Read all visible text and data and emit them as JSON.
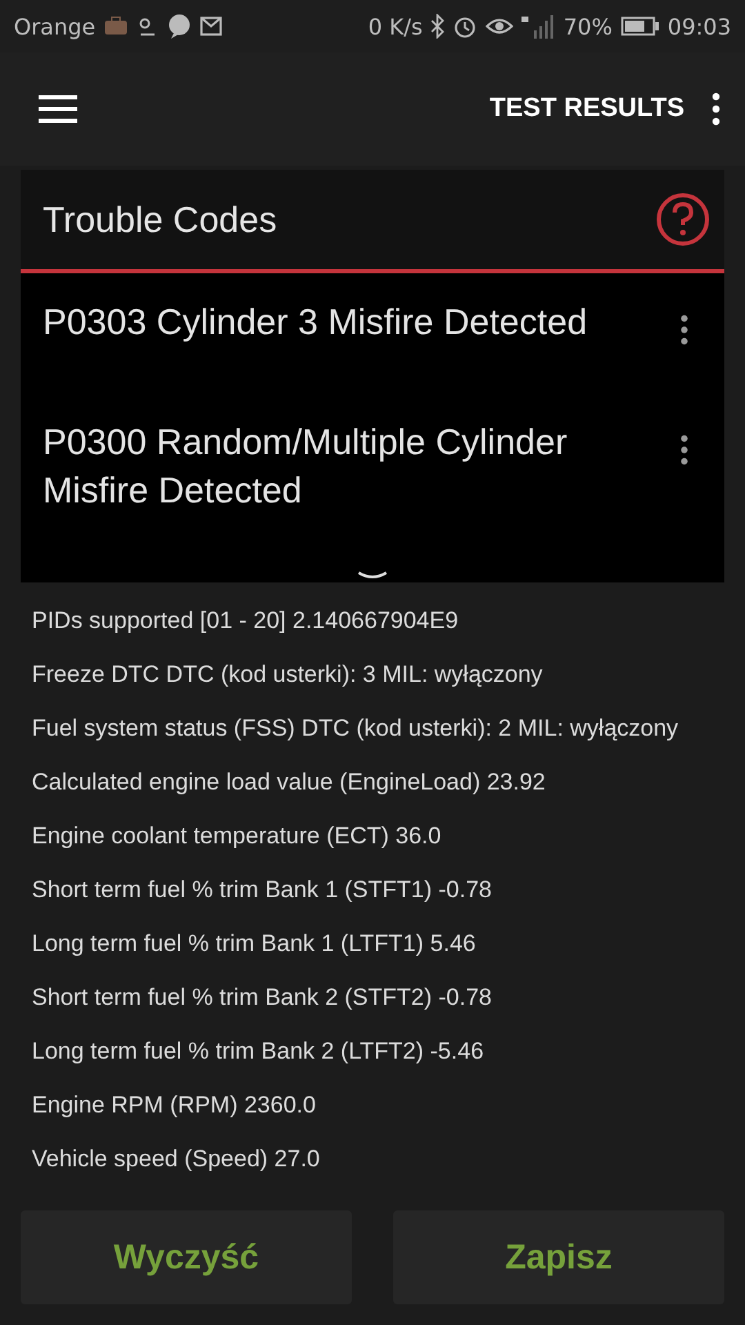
{
  "status_bar": {
    "carrier": "Orange",
    "speed": "0 K/s",
    "battery": "70%",
    "time": "09:03"
  },
  "app_bar": {
    "title": "TEST RESULTS"
  },
  "trouble_codes": {
    "title": "Trouble Codes",
    "codes": [
      {
        "code": "P0303",
        "description": "Cylinder 3 Misfire Detected"
      },
      {
        "code": "P0300",
        "description": "Random/Multiple Cylinder Misfire Detected"
      }
    ]
  },
  "readings": [
    "PIDs supported [01 - 20] 2.140667904E9",
    "Freeze DTC DTC (kod usterki): 3 MIL: wyłączony",
    "Fuel system status (FSS) DTC (kod usterki): 2 MIL: wyłączony",
    "Calculated engine load value (EngineLoad) 23.92",
    "Engine coolant temperature (ECT) 36.0",
    "Short term fuel % trim Bank 1 (STFT1) -0.78",
    "Long term fuel % trim Bank 1 (LTFT1) 5.46",
    "Short term fuel % trim Bank 2 (STFT2) -0.78",
    "Long term fuel % trim Bank 2 (LTFT2) -5.46",
    "Engine RPM (RPM) 2360.0",
    "Vehicle speed (Speed) 27.0"
  ],
  "buttons": [
    "Wyczyść",
    "Zapisz"
  ]
}
